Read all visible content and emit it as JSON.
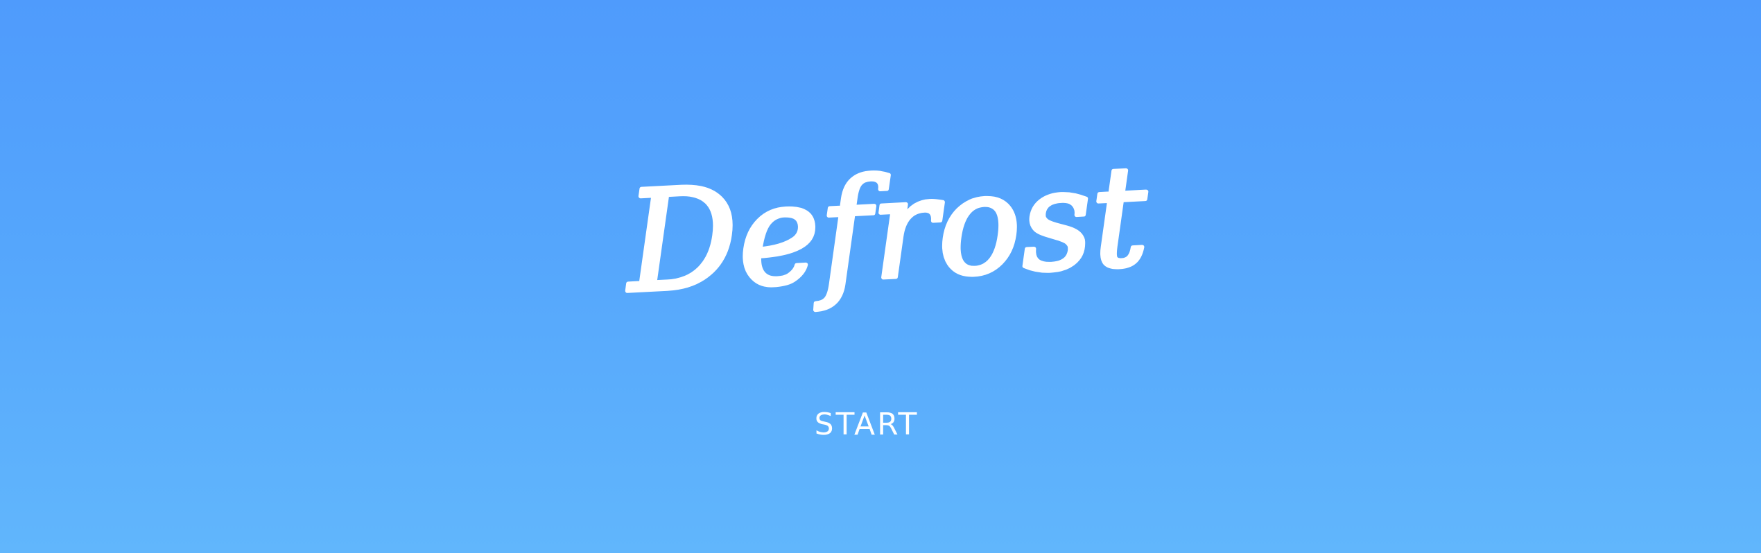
{
  "game": {
    "title": "Defrost",
    "start_label": "START"
  },
  "colors": {
    "background_top": "#4f9bfc",
    "background_bottom": "#61b6fc",
    "text": "#ffffff"
  }
}
